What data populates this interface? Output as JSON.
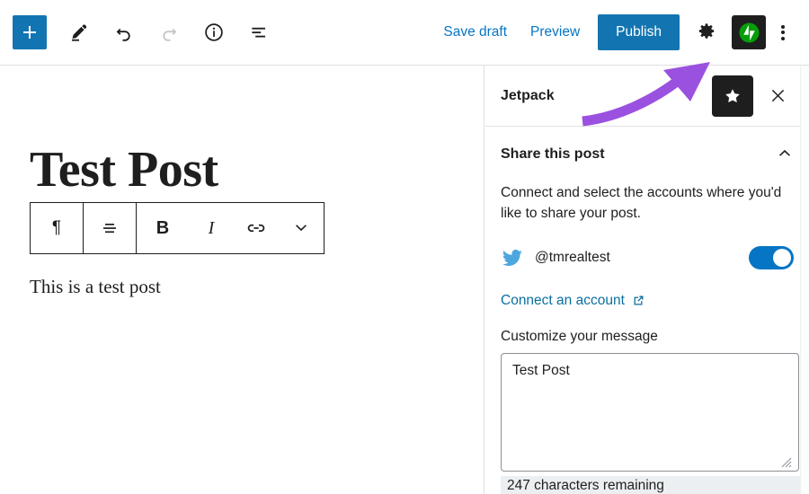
{
  "editor_header": {
    "add_block_label": "+",
    "tools": [
      {
        "name": "add-block-button",
        "icon": "plus-icon",
        "label": "+"
      },
      {
        "name": "edit-tool-button",
        "icon": "pencil-icon",
        "label": "Edit"
      },
      {
        "name": "undo-button",
        "icon": "undo-icon",
        "label": "Undo"
      },
      {
        "name": "redo-button",
        "icon": "redo-icon",
        "label": "Redo"
      },
      {
        "name": "details-button",
        "icon": "info-circle-icon",
        "label": "Details"
      },
      {
        "name": "list-view-button",
        "icon": "list-view-icon",
        "label": "List view"
      }
    ],
    "save_draft_label": "Save draft",
    "preview_label": "Preview",
    "publish_label": "Publish",
    "settings_icon": "gear-icon",
    "jetpack_icon": "jetpack-logo-icon",
    "more_options_icon": "kebab-menu-icon"
  },
  "canvas": {
    "post_title": "Test Post",
    "post_body": "This is a test post",
    "block_toolbar": [
      {
        "name": "block-type-paragraph-button",
        "icon": "paragraph-icon",
        "label": "¶"
      },
      {
        "name": "align-button",
        "icon": "align-icon",
        "label": ""
      },
      {
        "name": "bold-button",
        "icon": "bold-icon",
        "label": "B"
      },
      {
        "name": "italic-button",
        "icon": "italic-icon",
        "label": "I"
      },
      {
        "name": "link-button",
        "icon": "link-icon",
        "label": ""
      },
      {
        "name": "more-rich-text-button",
        "icon": "chevron-down-icon",
        "label": ""
      }
    ]
  },
  "sidebar": {
    "title": "Jetpack",
    "pin_icon": "star-icon",
    "close_icon": "close-icon",
    "section": {
      "title": "Share this post",
      "collapse_icon": "chevron-up-icon",
      "description": "Connect and select the accounts where you'd like to share your post.",
      "account": {
        "service_icon": "twitter-icon",
        "handle": "@tmrealtest",
        "toggle_state": "on"
      },
      "connect_link_label": "Connect an account",
      "connect_link_icon": "external-link-icon",
      "message_label": "Customize your message",
      "message_value": "Test Post",
      "message_placeholder": "",
      "characters_remaining": "247 characters remaining"
    }
  },
  "annotation": {
    "arrow_icon": "curved-arrow-annotation",
    "color": "#9b51e0"
  },
  "colors": {
    "accent_blue": "#1275b1",
    "link_blue": "#0675c4",
    "jetpack_green": "#069e08",
    "dark": "#1e1e1e",
    "annotation_purple": "#9b51e0",
    "toggle_on": "#0675c4"
  }
}
